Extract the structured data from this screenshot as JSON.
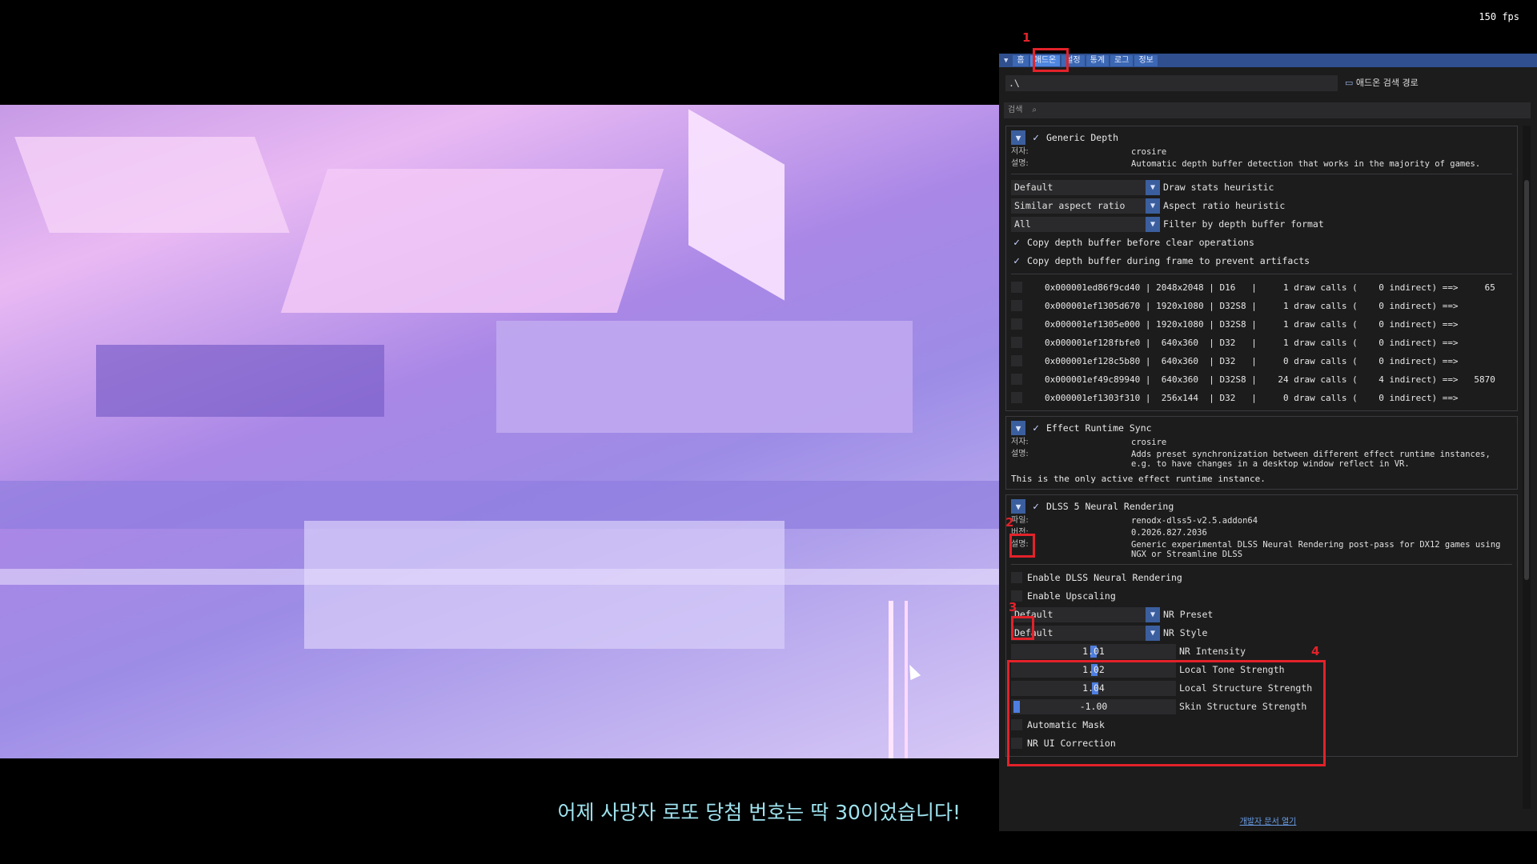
{
  "fps": "150 fps",
  "subtitle": "어제 사망자 로또 당첨 번호는 딱 30이었습니다!",
  "tabs": [
    "홈",
    "애드온",
    "설정",
    "통계",
    "로그",
    "정보"
  ],
  "path": {
    "value": ".\\",
    "button": "애드온 검색 경로"
  },
  "search": {
    "label": "검색"
  },
  "addons": {
    "generic": {
      "name": "Generic Depth",
      "author_key": "저자:",
      "author": "crosire",
      "desc_key": "설명:",
      "desc": "Automatic depth buffer detection that works in the majority of games.",
      "combos": [
        {
          "value": "Default",
          "label": "Draw stats heuristic"
        },
        {
          "value": "Similar aspect ratio",
          "label": "Aspect ratio heuristic"
        },
        {
          "value": "All",
          "label": "Filter by depth buffer format"
        }
      ],
      "checks": [
        "Copy depth buffer before clear operations",
        "Copy depth buffer during frame to prevent artifacts"
      ],
      "buffers": [
        "0x000001ed86f9cd40 | 2048x2048 | D16   |     1 draw calls (    0 indirect) ==>     65",
        "0x000001ef1305d670 | 1920x1080 | D32S8 |     1 draw calls (    0 indirect) ==>",
        "0x000001ef1305e000 | 1920x1080 | D32S8 |     1 draw calls (    0 indirect) ==>",
        "0x000001ef128fbfe0 |  640x360  | D32   |     1 draw calls (    0 indirect) ==>",
        "0x000001ef128c5b80 |  640x360  | D32   |     0 draw calls (    0 indirect) ==>",
        "0x000001ef49c89940 |  640x360  | D32S8 |    24 draw calls (    4 indirect) ==>   5870",
        "0x000001ef1303f310 |  256x144  | D32   |     0 draw calls (    0 indirect) ==>"
      ]
    },
    "sync": {
      "name": "Effect Runtime Sync",
      "author_key": "저자:",
      "author": "crosire",
      "desc_key": "설명:",
      "desc": "Adds preset synchronization between different effect runtime instances, e.g. to have changes in a desktop window reflect in VR.",
      "note": "This is the only active effect runtime instance."
    },
    "dlss": {
      "name": "DLSS 5 Neural Rendering",
      "file_key": "파일:",
      "file": "renodx-dlss5-v2.5.addon64",
      "ver_key": "버전:",
      "ver": "0.2026.827.2036",
      "desc_key": "설명:",
      "desc": "Generic experimental DLSS Neural Rendering post-pass for DX12 games using NGX or Streamline DLSS",
      "enable": "Enable DLSS Neural Rendering",
      "upscale": "Enable Upscaling",
      "combos": [
        {
          "value": "Default",
          "label": "NR Preset"
        },
        {
          "value": "Default",
          "label": "NR Style"
        }
      ],
      "sliders": [
        {
          "value": "1.01",
          "label": "NR Intensity"
        },
        {
          "value": "1.02",
          "label": "Local Tone Strength"
        },
        {
          "value": "1.04",
          "label": "Local Structure Strength"
        },
        {
          "value": "-1.00",
          "label": "Skin Structure Strength"
        }
      ],
      "extra": [
        "Automatic Mask",
        "NR UI Correction"
      ]
    }
  },
  "doc_link": "개발자 문서 열기",
  "markers": [
    "1",
    "2",
    "3",
    "4"
  ]
}
